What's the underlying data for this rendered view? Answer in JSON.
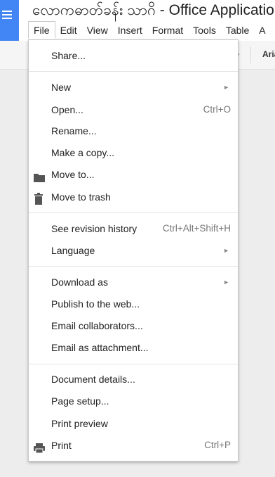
{
  "document": {
    "title": "လောကဓာတ်ခန်း သာဂိ  - Office Application"
  },
  "menubar": {
    "items": [
      "File",
      "Edit",
      "View",
      "Insert",
      "Format",
      "Tools",
      "Table",
      "A"
    ]
  },
  "toolbar": {
    "font_name": "Aria",
    "dropdown_arrow": "▾"
  },
  "file_menu": {
    "share": "Share...",
    "new": "New",
    "open": "Open...",
    "open_shortcut": "Ctrl+O",
    "rename": "Rename...",
    "make_copy": "Make a copy...",
    "move_to": "Move to...",
    "move_to_trash": "Move to trash",
    "revision_history": "See revision history",
    "revision_history_shortcut": "Ctrl+Alt+Shift+H",
    "language": "Language",
    "download_as": "Download as",
    "publish_web": "Publish to the web...",
    "email_collaborators": "Email collaborators...",
    "email_attachment": "Email as attachment...",
    "document_details": "Document details...",
    "page_setup": "Page setup...",
    "print_preview": "Print preview",
    "print": "Print",
    "print_shortcut": "Ctrl+P",
    "submenu_arrow": "►"
  },
  "colors": {
    "brand_blue": "#4285f4",
    "menu_text": "#222222",
    "shortcut_text": "#777777"
  }
}
